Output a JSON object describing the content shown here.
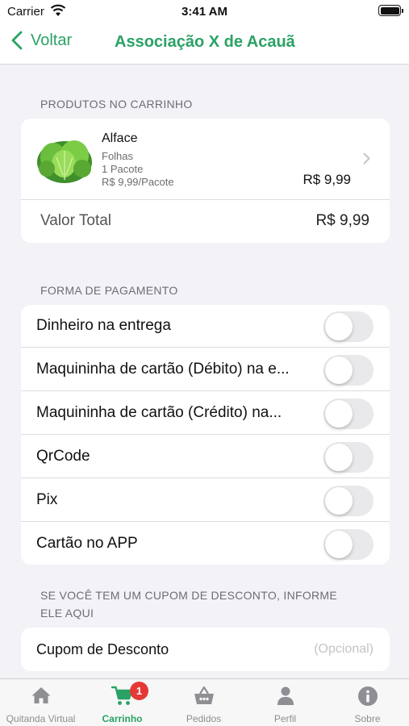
{
  "status_bar": {
    "carrier": "Carrier",
    "time": "3:41 AM"
  },
  "nav": {
    "back_label": "Voltar",
    "title": "Associação X de Acauã"
  },
  "cart": {
    "section_label": "PRODUTOS NO CARRINHO",
    "product": {
      "name": "Alface",
      "category": "Folhas",
      "quantity": "1 Pacote",
      "unit_price": "R$ 9,99/Pacote",
      "price": "R$ 9,99"
    },
    "total_label": "Valor Total",
    "total_value": "R$ 9,99"
  },
  "payment": {
    "section_label": "FORMA DE PAGAMENTO",
    "options": [
      {
        "label": "Dinheiro na entrega",
        "enabled": false
      },
      {
        "label": "Maquininha de cartão (Débito) na e...",
        "enabled": false
      },
      {
        "label": "Maquininha de cartão (Crédito) na...",
        "enabled": false
      },
      {
        "label": "QrCode",
        "enabled": false
      },
      {
        "label": "Pix",
        "enabled": false
      },
      {
        "label": "Cartão no APP",
        "enabled": false
      }
    ]
  },
  "coupon": {
    "section_label_line1": "SE VOCÊ TEM UM CUPOM DE DESCONTO, INFORME",
    "section_label_line2": "ELE AQUI",
    "label": "Cupom de Desconto",
    "placeholder": "(Opcional)",
    "value": ""
  },
  "tabs": [
    {
      "label": "Quitanda Virtual",
      "icon": "home-icon",
      "active": false
    },
    {
      "label": "Carrinho",
      "icon": "cart-icon",
      "active": true,
      "badge": "1"
    },
    {
      "label": "Pedidos",
      "icon": "basket-icon",
      "active": false
    },
    {
      "label": "Perfil",
      "icon": "person-icon",
      "active": false
    },
    {
      "label": "Sobre",
      "icon": "info-icon",
      "active": false
    }
  ],
  "colors": {
    "accent": "#2aa266",
    "badge": "#e53935",
    "background": "#f2f2f7"
  }
}
